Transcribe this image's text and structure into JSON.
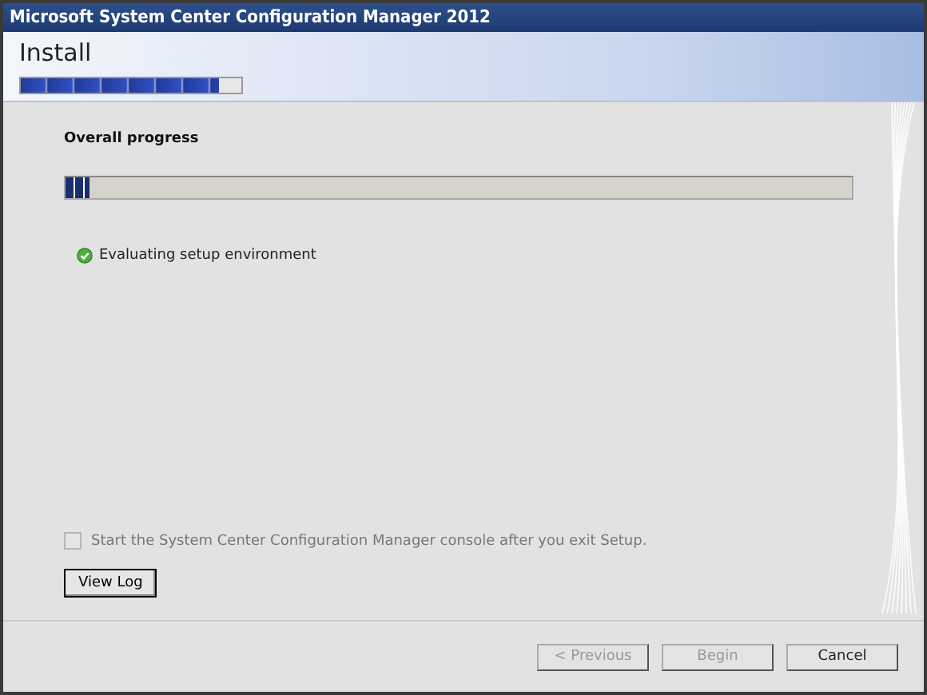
{
  "window": {
    "title": "Microsoft System Center Configuration Manager 2012"
  },
  "header": {
    "title": "Install",
    "stage_progress": {
      "level": 0.9
    }
  },
  "overall": {
    "label": "Overall progress",
    "level": 0.03
  },
  "steps": [
    {
      "label": "Evaluating setup environment",
      "done": true
    }
  ],
  "console_option": {
    "label": "Start the System Center Configuration Manager console after you exit Setup.",
    "checked": false,
    "disabled": true
  },
  "view_log": {
    "label": "View Log"
  },
  "buttons": [
    {
      "label": "< Previous",
      "disabled": true
    },
    {
      "label": "Begin",
      "disabled": true
    },
    {
      "label": "Cancel",
      "disabled": false
    }
  ]
}
